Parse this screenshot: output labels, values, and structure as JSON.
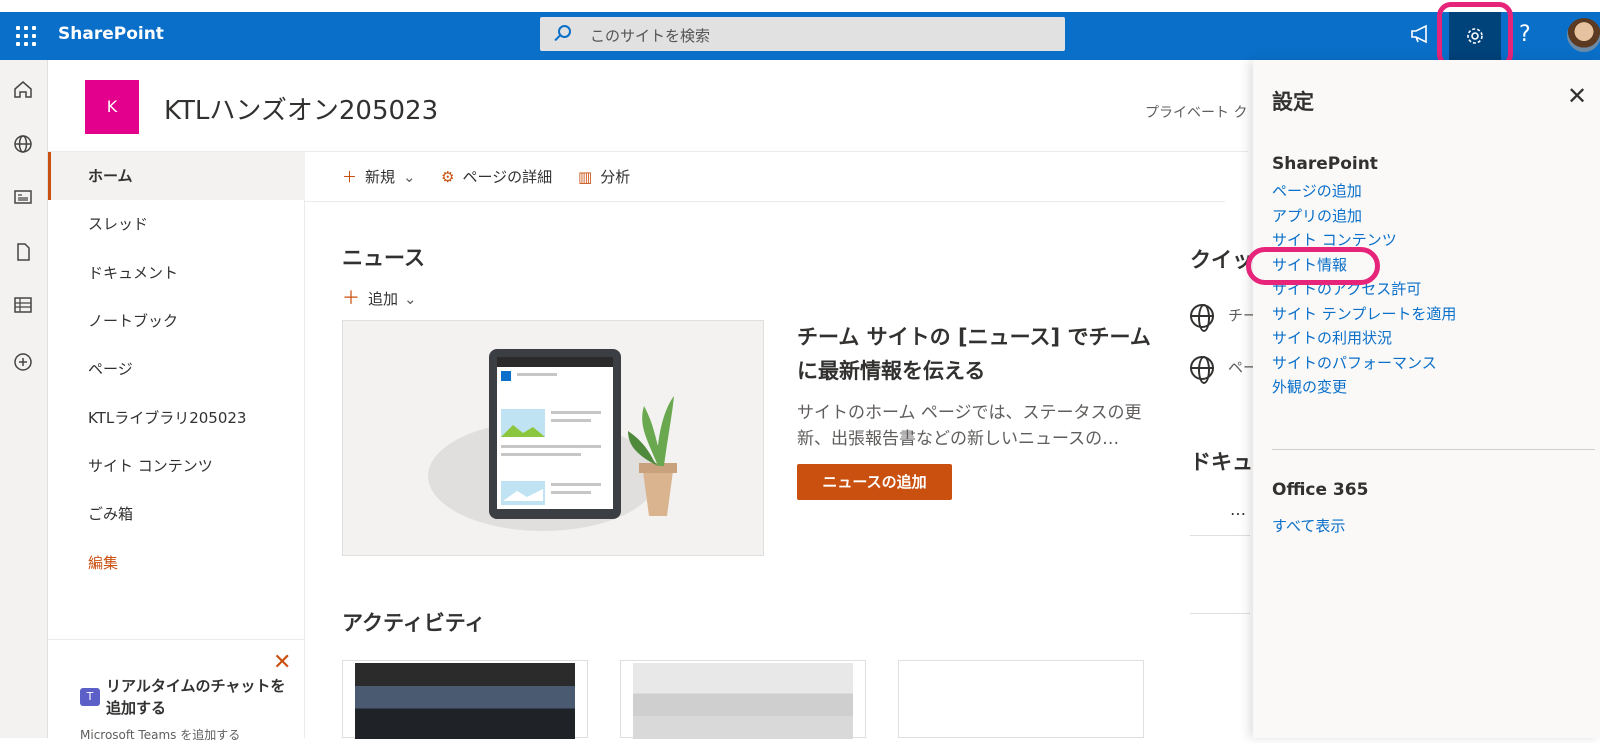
{
  "suite_bar": {
    "app_name": "SharePoint",
    "search_placeholder": "このサイトを検索",
    "icons": [
      "waffle-icon",
      "search-icon",
      "megaphone-icon",
      "gear-icon",
      "help-icon",
      "avatar"
    ]
  },
  "site": {
    "logo_letter": "K",
    "title": "KTLハンズオン205023",
    "privacy": "プライベート ク"
  },
  "left_nav": {
    "items": [
      {
        "label": "ホーム",
        "active": true
      },
      {
        "label": "スレッド"
      },
      {
        "label": "ドキュメント"
      },
      {
        "label": "ノートブック"
      },
      {
        "label": "ページ"
      },
      {
        "label": "KTLライブラリ205023"
      },
      {
        "label": "サイト コンテンツ"
      },
      {
        "label": "ごみ箱"
      },
      {
        "label": "編集"
      }
    ]
  },
  "teams_promo": {
    "title": "リアルタイムのチャットを追加する",
    "subtitle": "Microsoft Teams を追加する"
  },
  "command_bar": {
    "new_label": "新規",
    "page_details_label": "ページの詳細",
    "analytics_label": "分析"
  },
  "news": {
    "heading": "ニュース",
    "add_label": "追加",
    "headline": "チーム サイトの [ニュース] でチームに最新情報を伝える",
    "description": "サイトのホーム ページでは、ステータスの更新、出張報告書などの新しいニュースの…",
    "button_label": "ニュースの追加"
  },
  "activity": {
    "heading": "アクティビティ"
  },
  "quick_links": {
    "heading": "クイッ",
    "items": [
      "チー",
      "ペー"
    ]
  },
  "documents": {
    "heading": "ドキュ",
    "more": "…"
  },
  "settings_panel": {
    "title": "設定",
    "sharepoint_heading": "SharePoint",
    "links": [
      "ページの追加",
      "アプリの追加",
      "サイト コンテンツ",
      "サイト情報",
      "サイトのアクセス許可",
      "サイト テンプレートを適用",
      "サイトの利用状況",
      "サイトのパフォーマンス",
      "外観の変更"
    ],
    "office_heading": "Office 365",
    "office_link": "すべて表示"
  },
  "colors": {
    "suite_bar": "#0a6fc9",
    "accent": "#ca5010",
    "highlight_ring": "#e6247a",
    "site_logo": "#e3008c",
    "link": "#0a6fc9"
  }
}
